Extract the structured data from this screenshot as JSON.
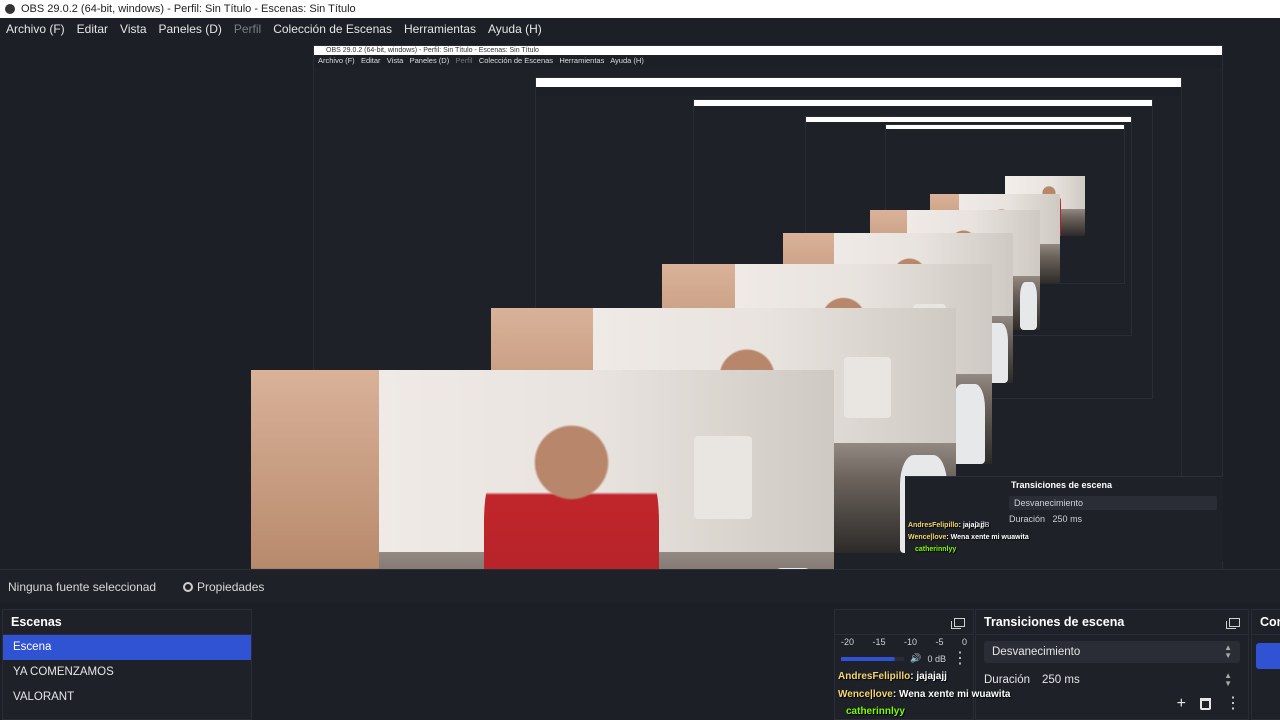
{
  "window": {
    "title": "OBS 29.0.2 (64-bit, windows) - Perfil: Sin Título - Escenas: Sin Título"
  },
  "menu": [
    {
      "label": "Archivo (F)",
      "enabled": true
    },
    {
      "label": "Editar",
      "enabled": true
    },
    {
      "label": "Vista",
      "enabled": true
    },
    {
      "label": "Paneles (D)",
      "enabled": true
    },
    {
      "label": "Perfil",
      "enabled": false
    },
    {
      "label": "Colección de Escenas",
      "enabled": true
    },
    {
      "label": "Herramientas",
      "enabled": true
    },
    {
      "label": "Ayuda (H)",
      "enabled": true
    }
  ],
  "nested_preview": {
    "title": "OBS 29.0.2 (64-bit, windows) - Perfil: Sin Título - Escenas: Sin Título",
    "menu": [
      "Archivo (F)",
      "Editar",
      "Vista",
      "Paneles (D)",
      "Perfil",
      "Colección de Escenas",
      "Herramientas",
      "Ayuda (H)"
    ],
    "transitions_title": "Transiciones de escena",
    "transition_value": "Desvanecimiento",
    "duration_label": "Duración",
    "duration_value": "250 ms",
    "chat": [
      {
        "user": "AndresFelipillo",
        "text": ": jajajajj"
      },
      {
        "user": "Wence|love",
        "text": ": Wena xente mi wuawita"
      },
      {
        "user": "catherinnlyy",
        "text": ""
      }
    ],
    "db": "0 dB"
  },
  "toolbar": {
    "no_source": "Ninguna fuente seleccionad",
    "properties": "Propiedades"
  },
  "scenes": {
    "title": "Escenas",
    "items": [
      "Escena",
      "YA COMENZAMOS",
      "VALORANT"
    ],
    "active_index": 0
  },
  "mixer": {
    "scale": [
      "-20",
      "-15",
      "-10",
      "-5",
      "0"
    ],
    "db": "0 dB"
  },
  "transitions": {
    "title": "Transiciones de escena",
    "selected": "Desvanecimiento",
    "duration_label": "Duración",
    "duration_value": "250 ms"
  },
  "controls": {
    "title": "Con"
  },
  "chat_overlay": [
    {
      "user": "AndresFelipillo",
      "text": ": jajajajj"
    },
    {
      "user": "Wence|love",
      "text": ": Wena xente mi wuawita"
    },
    {
      "user": "catherinnlyy",
      "text": ""
    }
  ],
  "colors": {
    "accent": "#2f53d3",
    "background": "#1d1f26",
    "panel": "#1f2129"
  }
}
